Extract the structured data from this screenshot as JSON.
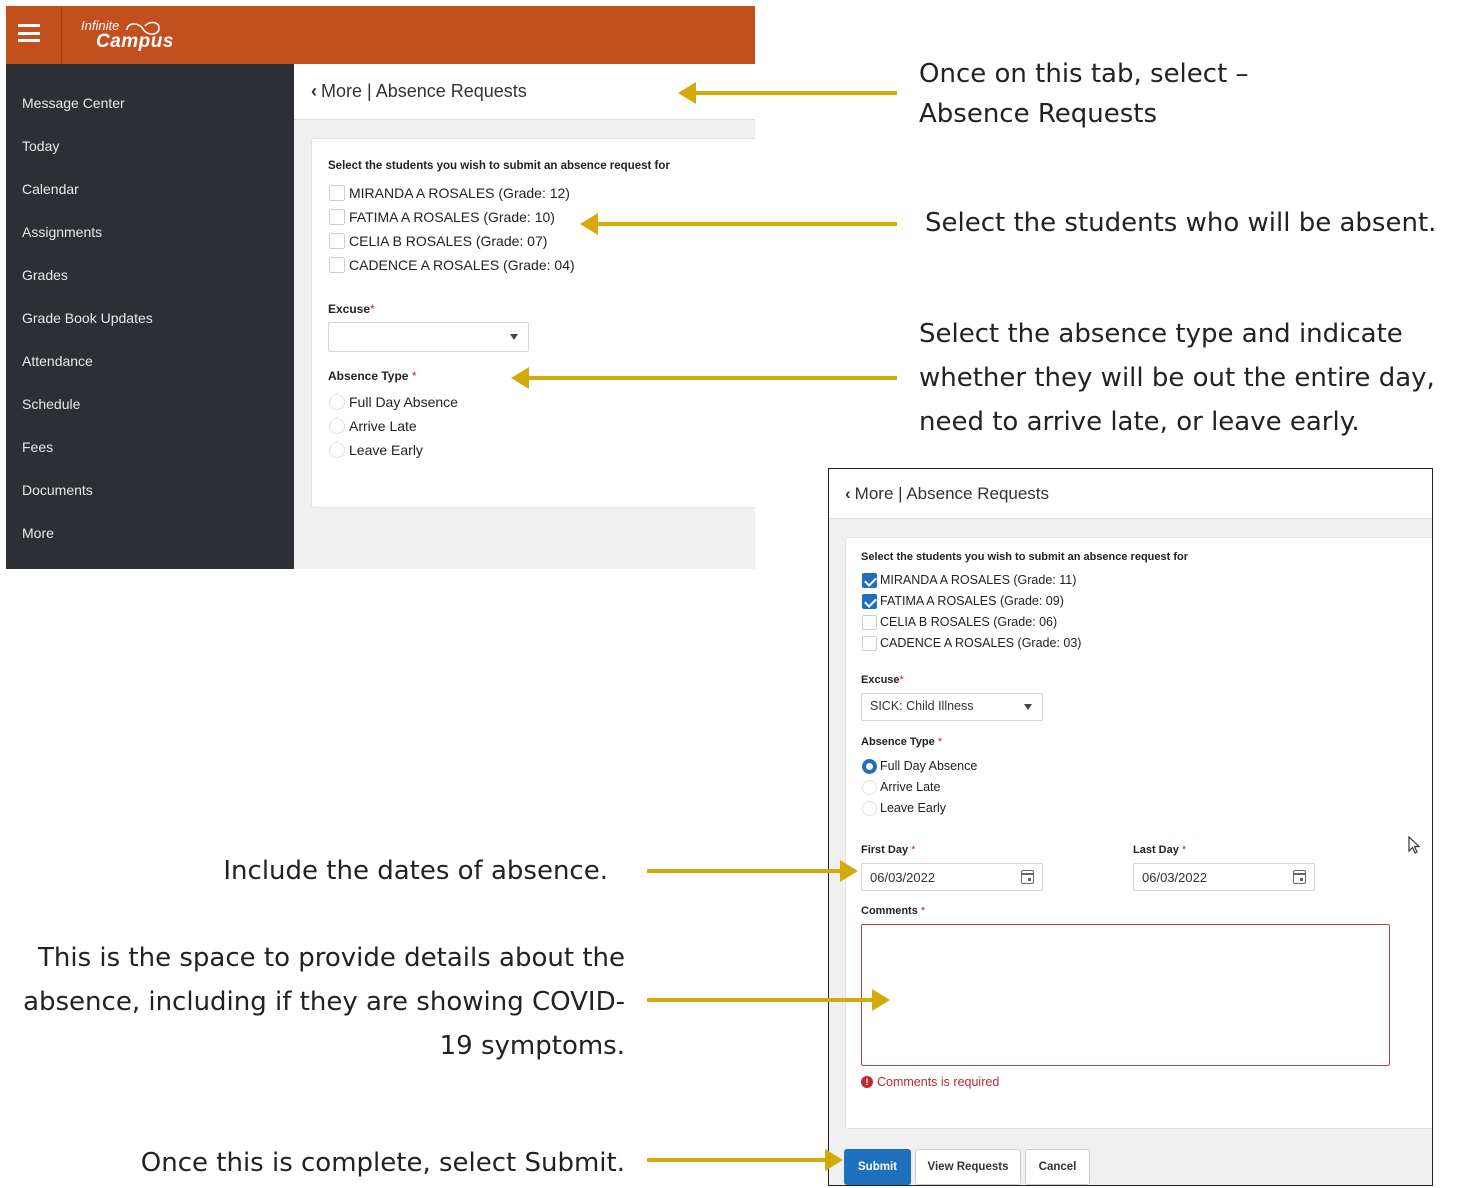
{
  "app": {
    "logo_text_top": "Infinite",
    "logo_text_bottom": "Campus",
    "brand_color": "#c34f1f",
    "sidebar_color": "#2c2f33",
    "accent_color": "#1f6fbf",
    "annotation_arrow_color": "#d4aa0a"
  },
  "sidebar": {
    "items": [
      {
        "label": "Message Center"
      },
      {
        "label": "Today"
      },
      {
        "label": "Calendar"
      },
      {
        "label": "Assignments"
      },
      {
        "label": "Grades"
      },
      {
        "label": "Grade Book Updates"
      },
      {
        "label": "Attendance"
      },
      {
        "label": "Schedule"
      },
      {
        "label": "Fees"
      },
      {
        "label": "Documents"
      },
      {
        "label": "More"
      }
    ]
  },
  "shot1": {
    "page_title": "More | Absence Requests",
    "prompt": "Select the students you wish to submit an absence request for",
    "students": [
      {
        "label": "MIRANDA A ROSALES (Grade: 12)",
        "checked": false
      },
      {
        "label": "FATIMA A ROSALES (Grade: 10)",
        "checked": false
      },
      {
        "label": "CELIA B ROSALES (Grade: 07)",
        "checked": false
      },
      {
        "label": "CADENCE A ROSALES (Grade: 04)",
        "checked": false
      }
    ],
    "excuse_label": "Excuse",
    "excuse_value": "",
    "absence_type_label": "Absence Type",
    "absence_types": [
      {
        "label": "Full Day Absence",
        "selected": false
      },
      {
        "label": "Arrive Late",
        "selected": false
      },
      {
        "label": "Leave Early",
        "selected": false
      }
    ]
  },
  "shot2": {
    "page_title": "More | Absence Requests",
    "prompt": "Select the students you wish to submit an absence request for",
    "students": [
      {
        "label": "MIRANDA A ROSALES (Grade: 11)",
        "checked": true
      },
      {
        "label": "FATIMA A ROSALES (Grade: 09)",
        "checked": true
      },
      {
        "label": "CELIA B ROSALES (Grade: 06)",
        "checked": false
      },
      {
        "label": "CADENCE A ROSALES (Grade: 03)",
        "checked": false
      }
    ],
    "excuse_label": "Excuse",
    "excuse_value": "SICK: Child Illness",
    "absence_type_label": "Absence Type",
    "absence_types": [
      {
        "label": "Full Day Absence",
        "selected": true
      },
      {
        "label": "Arrive Late",
        "selected": false
      },
      {
        "label": "Leave Early",
        "selected": false
      }
    ],
    "first_day_label": "First Day",
    "first_day_value": "06/03/2022",
    "last_day_label": "Last Day",
    "last_day_value": "06/03/2022",
    "comments_label": "Comments",
    "comments_value": "",
    "comments_error": "Comments is required",
    "buttons": {
      "submit": "Submit",
      "view_requests": "View Requests",
      "cancel": "Cancel"
    }
  },
  "required_marker": "*",
  "annotations": {
    "tab_line1": "Once on this tab, select –",
    "tab_line2": "Absence Requests",
    "students": "Select the students who will be absent.",
    "type_line1": "Select the absence type and indicate",
    "type_line2": "whether they will be out the entire day,",
    "type_line3": "need to arrive late, or leave early.",
    "dates": "Include the dates of absence.",
    "comments_line1": "This is the space to provide details about the",
    "comments_line2": "absence, including if they are showing COVID-",
    "comments_line3": "19 symptoms.",
    "submit": "Once this is complete, select Submit."
  }
}
